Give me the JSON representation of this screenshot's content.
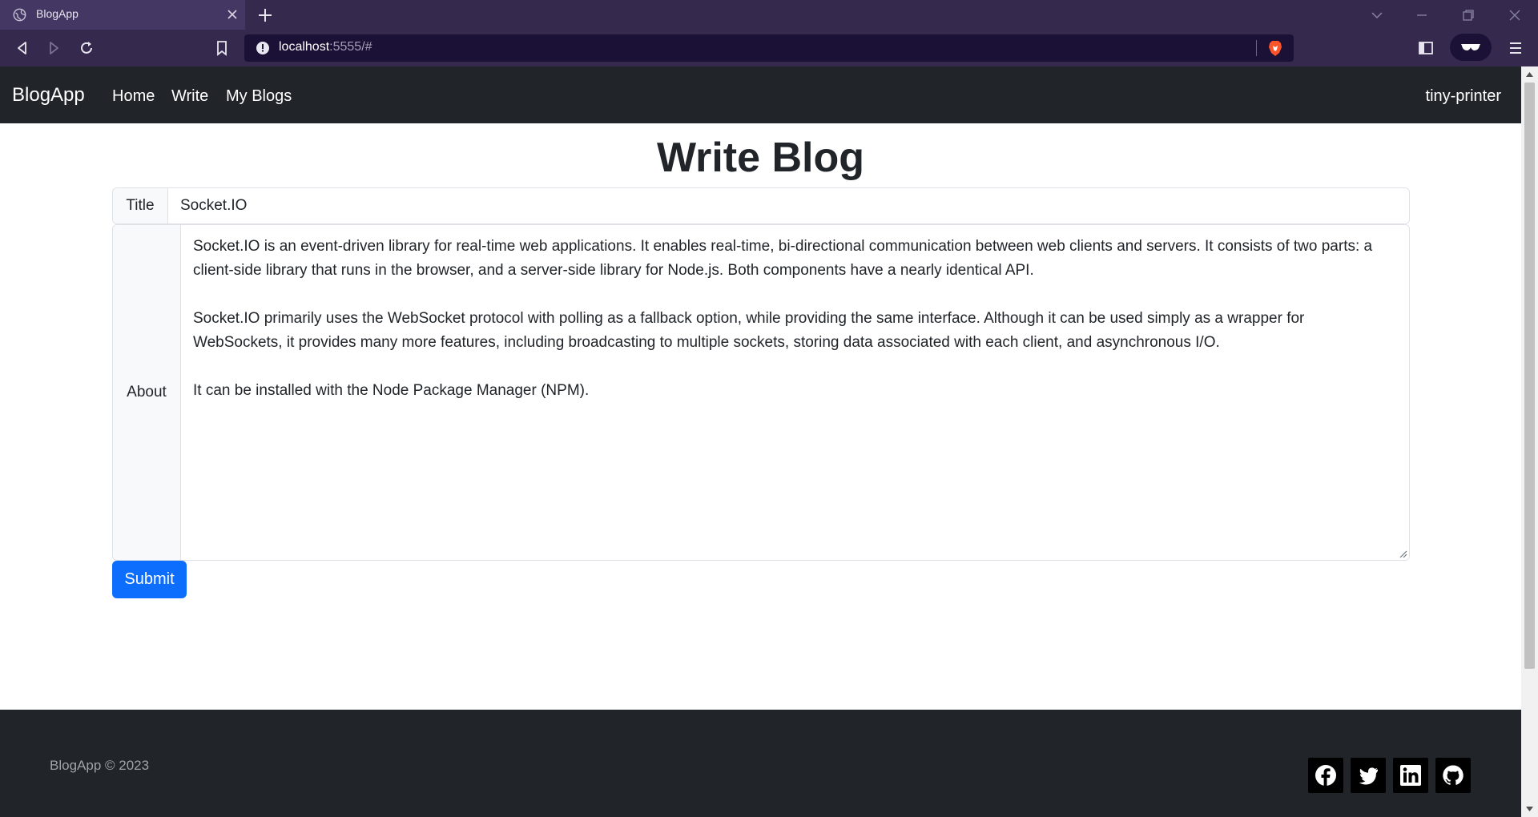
{
  "browser": {
    "tab_title": "BlogApp",
    "url_host": "localhost",
    "url_rest": ":5555/#"
  },
  "nav": {
    "brand": "BlogApp",
    "links": [
      "Home",
      "Write",
      "My Blogs"
    ],
    "user": "tiny-printer"
  },
  "page": {
    "heading": "Write Blog"
  },
  "form": {
    "title_label": "Title",
    "title_value": "Socket.IO",
    "about_label": "About",
    "about_value": "Socket.IO is an event-driven library for real-time web applications. It enables real-time, bi-directional communication between web clients and servers. It consists of two parts: a client-side library that runs in the browser, and a server-side library for Node.js. Both components have a nearly identical API.\n\nSocket.IO primarily uses the WebSocket protocol with polling as a fallback option, while providing the same interface. Although it can be used simply as a wrapper for WebSockets, it provides many more features, including broadcasting to multiple sockets, storing data associated with each client, and asynchronous I/O.\n\nIt can be installed with the Node Package Manager (NPM).",
    "submit_label": "Submit"
  },
  "footer": {
    "copyright": "BlogApp © 2023",
    "social_icons": [
      "facebook-icon",
      "twitter-icon",
      "linkedin-icon",
      "github-icon"
    ]
  },
  "colors": {
    "navbar": "#212529",
    "primary": "#0d6efd",
    "browser_chrome": "#35294e"
  }
}
